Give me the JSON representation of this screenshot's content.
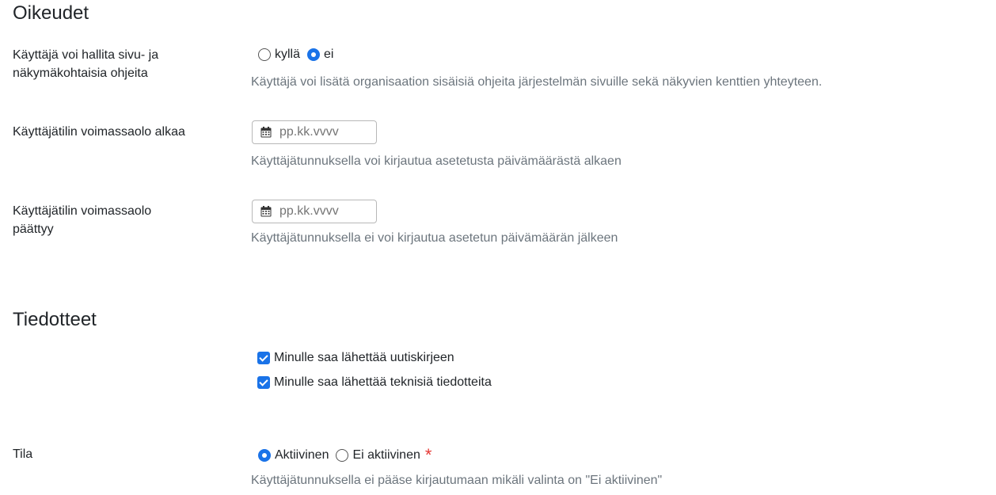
{
  "sections": {
    "rights_title": "Oikeudet",
    "notices_title": "Tiedotteet"
  },
  "help_management": {
    "label": "Käyttäjä voi hallita sivu- ja näkymäkohtaisia ohjeita",
    "options": [
      "kyllä",
      "ei"
    ],
    "selected": "ei",
    "help": "Käyttäjä voi lisätä organisaation sisäisiä ohjeita järjestelmän sivuille sekä näkyvien kenttien yhteyteen."
  },
  "valid_from": {
    "label": "Käyttäjätilin voimassaolo alkaa",
    "placeholder": "pp.kk.vvvv",
    "value": "",
    "help": "Käyttäjätunnuksella voi kirjautua asetetusta päivämäärästä alkaen"
  },
  "valid_until": {
    "label": "Käyttäjätilin voimassaolo päättyy",
    "placeholder": "pp.kk.vvvv",
    "value": "",
    "help": "Käyttäjätunnuksella ei voi kirjautua asetetun päivämäärän jälkeen"
  },
  "notices": {
    "newsletter": {
      "label": "Minulle saa lähettää uutiskirjeen",
      "checked": true
    },
    "technical": {
      "label": "Minulle saa lähettää teknisiä tiedotteita",
      "checked": true
    }
  },
  "status": {
    "label": "Tila",
    "options": [
      "Aktiivinen",
      "Ei aktiivinen"
    ],
    "selected": "Aktiivinen",
    "required_mark": "*",
    "help": "Käyttäjätunnuksella ei pääse kirjautumaan mikäli valinta on \"Ei aktiivinen\""
  },
  "colors": {
    "accent": "#1a73e8",
    "help_text": "#6c757d",
    "required": "#e53935"
  }
}
